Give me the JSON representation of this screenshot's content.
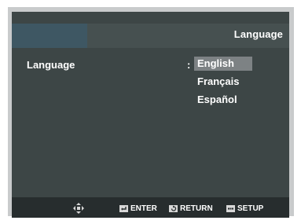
{
  "header": {
    "title": "Language"
  },
  "menu": {
    "label": "Language",
    "separator": ":",
    "options": [
      "English",
      "Français",
      "Español"
    ],
    "selected_index": 0
  },
  "footer": {
    "nav_icon": "direction-pad-icon",
    "enter": {
      "icon": "enter-icon",
      "label": "ENTER"
    },
    "return": {
      "icon": "return-icon",
      "label": "RETURN"
    },
    "setup": {
      "icon": "setup-icon",
      "label": "SETUP"
    }
  },
  "colors": {
    "panel": "#3d4646",
    "header_tab": "#3e5763",
    "selection": "#7d8284",
    "footer": "#272d2e"
  }
}
